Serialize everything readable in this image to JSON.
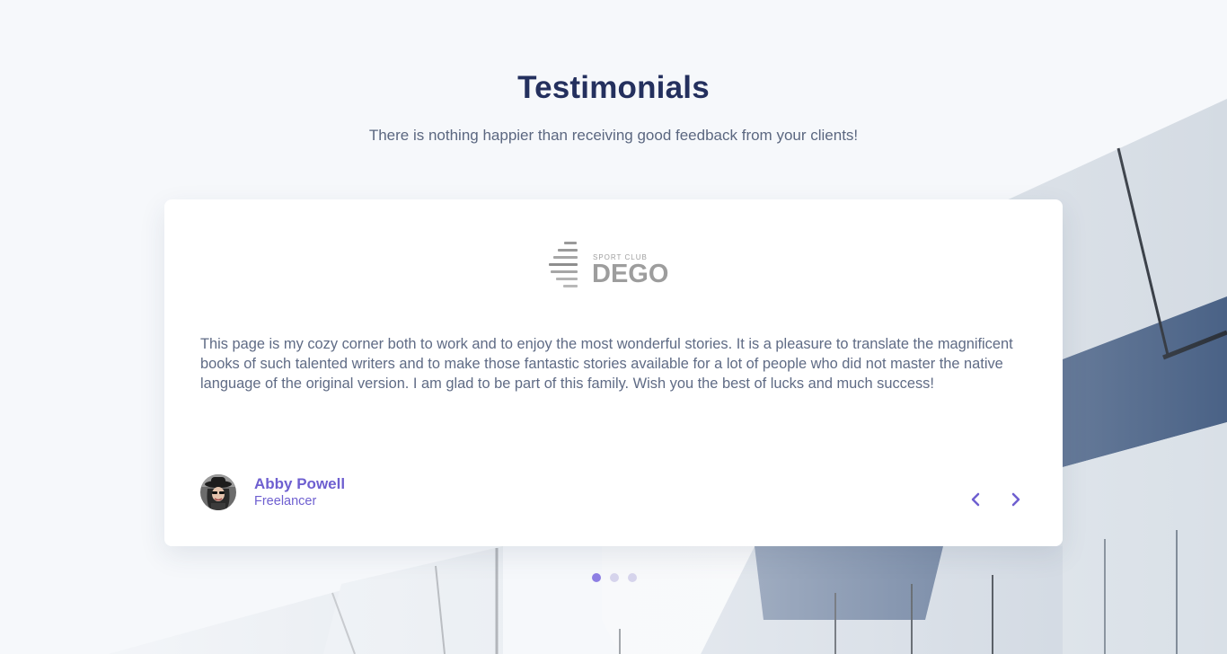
{
  "section": {
    "title": "Testimonials",
    "subtitle": "There is nothing happier than receiving good feedback from your clients!"
  },
  "testimonial": {
    "logo": {
      "top_text": "SPORT CLUB",
      "main_text": "DEGO"
    },
    "quote": "This page is my cozy corner both to work and to enjoy the most wonderful stories. It is a pleasure to translate the magnificent books of such talented writers and to make those fantastic stories available for a lot of people who did not master the native language of the original version. I am glad to be part of this family. Wish you the best of lucks and much success!",
    "author_name": "Abby Powell",
    "author_role": "Freelancer"
  },
  "navigation": {
    "prev_icon": "chevron-left-icon",
    "next_icon": "chevron-right-icon",
    "slide_count": 3,
    "active_slide": 1
  },
  "colors": {
    "title": "#24305e",
    "body_text": "#5f6b85",
    "accent": "#6e5fd0",
    "dot_active": "#8d7ee3",
    "dot_inactive": "#d6d4ec"
  }
}
